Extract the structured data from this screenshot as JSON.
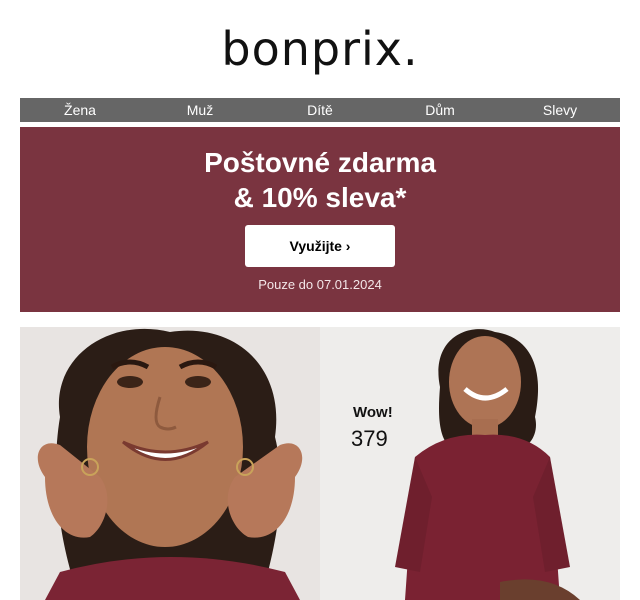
{
  "brand": {
    "logo_text": "bonprix."
  },
  "nav": {
    "items": [
      "Žena",
      "Muž",
      "Dítě",
      "Dům",
      "Slevy"
    ]
  },
  "promo": {
    "title_line1": "Poštovné zdarma",
    "title_line2": "& 10% sleva*",
    "button_label": "Využijte ›",
    "note": "Pouze do 07.01.2024",
    "background_color": "#7a3440"
  },
  "hero": {
    "badge_label": "Wow!",
    "price": "379"
  }
}
